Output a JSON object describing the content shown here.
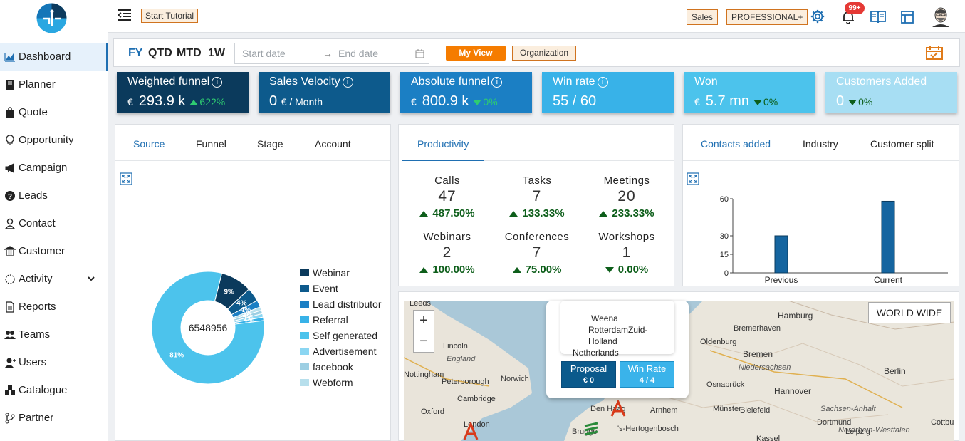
{
  "sidebar": {
    "items": [
      {
        "label": "Dashboard",
        "icon": "chart-area-icon",
        "active": true
      },
      {
        "label": "Planner",
        "icon": "book-icon"
      },
      {
        "label": "Quote",
        "icon": "shopping-bag-icon"
      },
      {
        "label": "Opportunity",
        "icon": "lightbulb-icon"
      },
      {
        "label": "Campaign",
        "icon": "megaphone-icon"
      },
      {
        "label": "Leads",
        "icon": "question-circle-icon"
      },
      {
        "label": "Contact",
        "icon": "user-icon"
      },
      {
        "label": "Customer",
        "icon": "bank-icon"
      },
      {
        "label": "Activity",
        "icon": "activity-icon",
        "has_submenu": true
      },
      {
        "label": "Reports",
        "icon": "file-icon"
      },
      {
        "label": "Teams",
        "icon": "users-icon"
      },
      {
        "label": "Users",
        "icon": "user-plus-icon"
      },
      {
        "label": "Catalogue",
        "icon": "boxes-icon"
      },
      {
        "label": "Partner",
        "icon": "branch-icon"
      }
    ]
  },
  "topbar": {
    "tutorial_label": "Start Tutorial",
    "sales_tag": "Sales",
    "plan_tag": "PROFESSIONAL+",
    "notification_count": "99+"
  },
  "filters": {
    "periods": [
      "FY",
      "QTD",
      "MTD",
      "1W"
    ],
    "active_period": "FY",
    "start_placeholder": "Start date",
    "end_placeholder": "End date",
    "my_view_label": "My View",
    "organization_label": "Organization"
  },
  "kpis": [
    {
      "title": "Weighted funnel",
      "currency": "€",
      "value": "293.9 k",
      "change": "622%",
      "trend": "up",
      "info": true,
      "color": "#0b3a5c"
    },
    {
      "title": "Sales Velocity",
      "value": "0",
      "unit": "€ / Month",
      "info": true,
      "color": "#0d5a8c"
    },
    {
      "title": "Absolute funnel",
      "currency": "€",
      "value": "800.9 k",
      "change": "0%",
      "trend": "down",
      "info": true,
      "color": "#1b7fc4"
    },
    {
      "title": "Win rate",
      "value": "55 / 60",
      "info": true,
      "color": "#38b2e8"
    },
    {
      "title": "Won",
      "currency": "€",
      "value": "5.7 mn",
      "change": "0%",
      "trend": "down",
      "color": "#4cc3ec"
    },
    {
      "title": "Customers Added",
      "value": "0",
      "change": "0%",
      "trend": "down",
      "color": "#a7def3"
    }
  ],
  "source_panel": {
    "tabs": [
      "Source",
      "Funnel",
      "Stage",
      "Account"
    ],
    "active_tab": "Source",
    "donut_total": "6548956",
    "chart_data": {
      "type": "pie",
      "labels": [
        "Webinar",
        "Event",
        "Lead distributor",
        "Referral",
        "Self generated",
        "Advertisement",
        "facebook",
        "Webform"
      ],
      "colors": [
        "#0b3a5c",
        "#0d5a8c",
        "#1b7fc4",
        "#38b2e8",
        "#4cc3ec",
        "#8bd6f2",
        "#9dcfe3",
        "#b7dfec"
      ],
      "values": [
        9,
        4,
        2,
        1,
        81,
        1,
        1,
        1
      ],
      "value_labels": [
        "9%",
        "4%",
        "4%",
        "1%",
        "81%",
        "1%",
        "4%",
        "1%"
      ]
    }
  },
  "productivity": {
    "tab": "Productivity",
    "items": [
      {
        "label": "Calls",
        "value": "47",
        "change": "487.50%",
        "trend": "up"
      },
      {
        "label": "Tasks",
        "value": "7",
        "change": "133.33%",
        "trend": "up"
      },
      {
        "label": "Meetings",
        "value": "20",
        "change": "233.33%",
        "trend": "up"
      },
      {
        "label": "Webinars",
        "value": "2",
        "change": "100.00%",
        "trend": "up"
      },
      {
        "label": "Conferences",
        "value": "7",
        "change": "75.00%",
        "trend": "up"
      },
      {
        "label": "Workshops",
        "value": "1",
        "change": "0.00%",
        "trend": "down"
      }
    ]
  },
  "contacts_panel": {
    "tabs": [
      "Contacts added",
      "Industry",
      "Customer split"
    ],
    "active_tab": "Contacts added",
    "chart_data": {
      "type": "bar",
      "categories": [
        "Previous",
        "Current"
      ],
      "values": [
        30,
        58
      ],
      "ylim": [
        0,
        60
      ],
      "yticks": [
        "60",
        "30",
        "15",
        "0"
      ],
      "color": "#1565a0"
    }
  },
  "map": {
    "world_wide_label": "WORLD WIDE",
    "zoom_in": "+",
    "zoom_out": "−",
    "popup": {
      "line1": "Weena",
      "line2": "RotterdamZuid-Holland",
      "line3": "Netherlands",
      "proposal_label": "Proposal",
      "proposal_value": "€ 0",
      "winrate_label": "Win Rate",
      "winrate_value": "4 / 4"
    },
    "places": [
      "Leeds",
      "Lincoln",
      "England",
      "Nottingham",
      "Peterborough",
      "Norwich",
      "Cambridge",
      "Oxford",
      "London",
      "Brugge",
      "Den Haag",
      "'s-Hertogenbosch",
      "Arnhem",
      "Hamburg",
      "Bremerhaven",
      "Oldenburg",
      "Bremen",
      "Niedersachsen",
      "Berlin",
      "Osnabrück",
      "Hannover",
      "Münster",
      "Bielefeld",
      "Sachsen-Anhalt",
      "Dortmund",
      "Nordrhein-Westfalen",
      "Kassel",
      "Leipzig",
      "Cottbus"
    ]
  }
}
